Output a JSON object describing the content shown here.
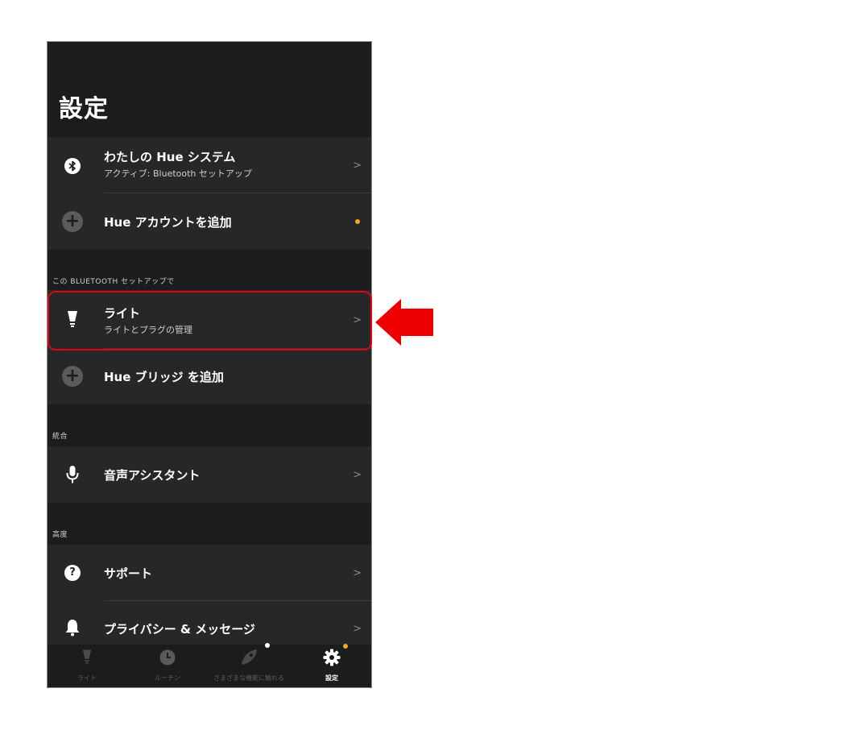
{
  "page": {
    "title": "設定"
  },
  "hue_system": {
    "title": "わたしの Hue システム",
    "subtitle": "アクティブ: Bluetooth セットアップ",
    "chevron": ">"
  },
  "add_account": {
    "label": "Hue アカウントを追加"
  },
  "section_bluetooth": {
    "label": "この BLUETOOTH セットアップで"
  },
  "lights": {
    "title": "ライト",
    "subtitle": "ライトとプラグの管理",
    "chevron": ">"
  },
  "add_bridge": {
    "label": "Hue ブリッジ を追加"
  },
  "section_integration": {
    "label": "統合"
  },
  "voice": {
    "label": "音声アシスタント",
    "chevron": ">"
  },
  "section_advanced": {
    "label": "高度"
  },
  "support": {
    "label": "サポート",
    "chevron": ">"
  },
  "privacy": {
    "label": "プライバシー & メッセージ",
    "chevron": ">"
  },
  "tabs": [
    {
      "label": "ライト",
      "icon": "lamp-icon",
      "active": false
    },
    {
      "label": "ルーチン",
      "icon": "clock-icon",
      "active": false
    },
    {
      "label": "さまざまな機能に触れる",
      "icon": "rocket-icon",
      "active": false
    },
    {
      "label": "設定",
      "icon": "gear-icon",
      "active": true
    }
  ],
  "colors": {
    "background": "#1b1c1d",
    "panel": "#262728",
    "accent": "#f5a623",
    "highlight": "#e8000b"
  }
}
